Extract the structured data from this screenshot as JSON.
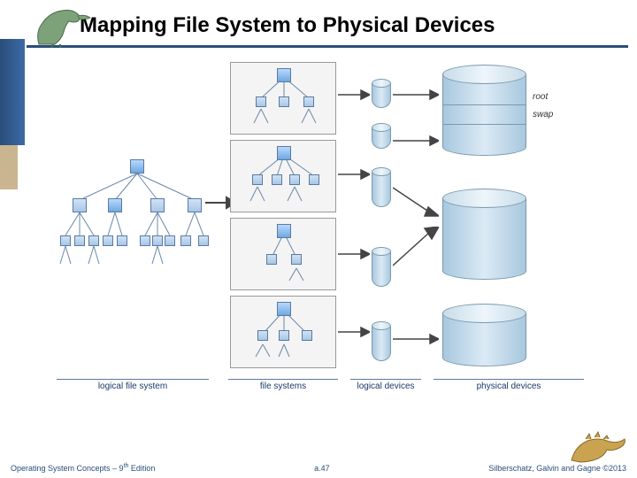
{
  "slide": {
    "title": "Mapping File System to Physical Devices",
    "page_label": "a.47"
  },
  "footer": {
    "left_prefix": "Operating System Concepts – 9",
    "left_suffix": " Edition",
    "left_sup": "th",
    "right": "Silberschatz, Galvin and Gagne ©2013"
  },
  "figure": {
    "columns": {
      "logical_fs": "logical file system",
      "file_systems": "file systems",
      "logical_devices": "logical devices",
      "physical_devices": "physical devices"
    },
    "disk_labels": {
      "root": "root",
      "swap": "swap"
    }
  }
}
